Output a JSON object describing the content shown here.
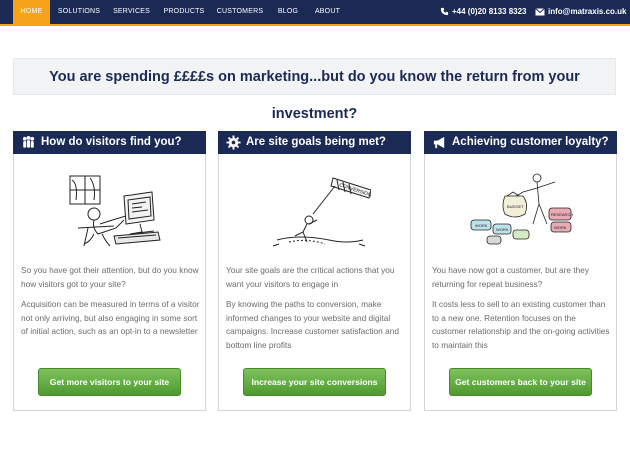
{
  "nav": {
    "items": [
      "HOME",
      "SOLUTIONS",
      "SERVICES",
      "PRODUCTS",
      "CUSTOMERS",
      "BLOG",
      "ABOUT"
    ],
    "phone": "+44 (0)20 8133 8323",
    "email": "info@matraxis.co.uk",
    "accent": "#f5a318",
    "background": "#1b2a55"
  },
  "banner": {
    "title": "You are spending ££££s on marketing...but do you know the return from your investment?"
  },
  "cards": [
    {
      "icon": "people-icon",
      "title": "How do visitors find you?",
      "para1": "So you have got their attention, but do you know how visitors got to your site?",
      "para2": "Acquisition can be measured in terms of a visitor not only arriving, but also engaging in some sort of initial action, such as an opt-in to a newsletter",
      "button": "Get more visitors to your site"
    },
    {
      "icon": "gear-icon",
      "title": "Are site goals being met?",
      "para1": "Your site goals are the critical actions that you want your visitors to engage in",
      "para2": "By knowing the paths to conversion, make informed changes to your website and digital campaigns. Increase customer satisfaction and bottom line profits",
      "button": "Increase your site conversions",
      "illustration_text": "CONVERSIONS"
    },
    {
      "icon": "megaphone-icon",
      "title": "Achieving customer loyalty?",
      "para1": "You have now got a customer, but are they returning for repeat business?",
      "para2": "It costs less to sell to an existing customer than to a new one. Retention focuses on the customer relationship and the on-going activities to maintain this",
      "button": "Get customers back to your site",
      "illustration_labels": [
        "BUDGET",
        "WORK",
        "WORK",
        "RESEARCH",
        "WORK"
      ]
    }
  ],
  "colors": {
    "button_green": "#5fa83c",
    "header_navy": "#1b2a55"
  }
}
